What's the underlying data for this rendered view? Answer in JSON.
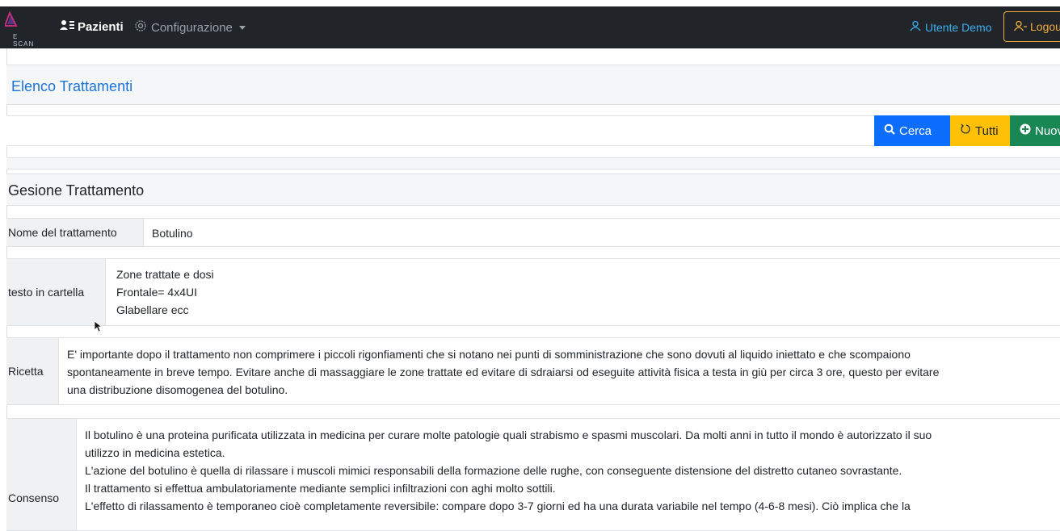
{
  "navbar": {
    "logo_text": "E SCAN",
    "pazienti_label": "Pazienti",
    "configurazione_label": "Configurazione",
    "user_label": "Utente Demo",
    "logout_label": "Logou"
  },
  "page": {
    "title": "Elenco Trattamenti"
  },
  "toolbar": {
    "cerca_label": "Cerca",
    "tutti_label": "Tutti",
    "nuovo_label": "Nuov"
  },
  "section": {
    "title": "Gesione Trattamento"
  },
  "fields": {
    "nome": {
      "label": "Nome del trattamento",
      "value": "Botulino"
    },
    "testo": {
      "label": "testo in cartella",
      "lines": [
        "Zone trattate e dosi",
        "Frontale= 4x4UI",
        "Glabellare ecc"
      ]
    },
    "ricetta": {
      "label": "Ricetta",
      "lines": [
        "E' importante dopo il trattamento non comprimere i piccoli rigonfiamenti che si notano nei punti di somministrazione che sono dovuti al liquido iniettato e che scompaiono",
        "spontaneamente in breve tempo. Evitare anche di massaggiare le zone trattate ed evitare di sdraiarsi od eseguite attività fisica a testa in giù per circa 3 ore, questo per evitare",
        "una distribuzione disomogenea del botulino."
      ]
    },
    "consenso": {
      "label": "Consenso",
      "lines": [
        "Il botulino è una proteina purificata utilizzata in medicina per curare molte patologie quali strabismo e spasmi muscolari. Da molti anni in tutto il mondo è autorizzato il suo",
        "utilizzo in medicina estetica.",
        "L'azione del botulino è quella di rilassare i muscoli mimici responsabili della formazione delle rughe, con conseguente distensione del distretto cutaneo sovrastante.",
        "Il trattamento si effettua ambulatoriamente mediante semplici infiltrazioni con aghi molto sottili.",
        "L'effetto di rilassamento è temporaneo cioè completamente reversibile: compare dopo 3-7 giorni ed ha una durata variabile nel tempo (4-6-8 mesi). Ciò implica che la"
      ]
    }
  },
  "icons": {
    "pazienti": "users-list-icon",
    "configurazione": "gear-icon",
    "user": "user-icon",
    "logout": "user-minus-icon",
    "cerca": "search-icon",
    "tutti": "refresh-icon",
    "nuovo": "plus-circle-icon"
  },
  "colors": {
    "navbar": "#212529",
    "title": "#1a73d8",
    "cerca": "#0d6efd",
    "tutti": "#ffc107",
    "nuovo": "#198754",
    "logout": "#f0ad3c",
    "user": "#3ab0f0"
  }
}
